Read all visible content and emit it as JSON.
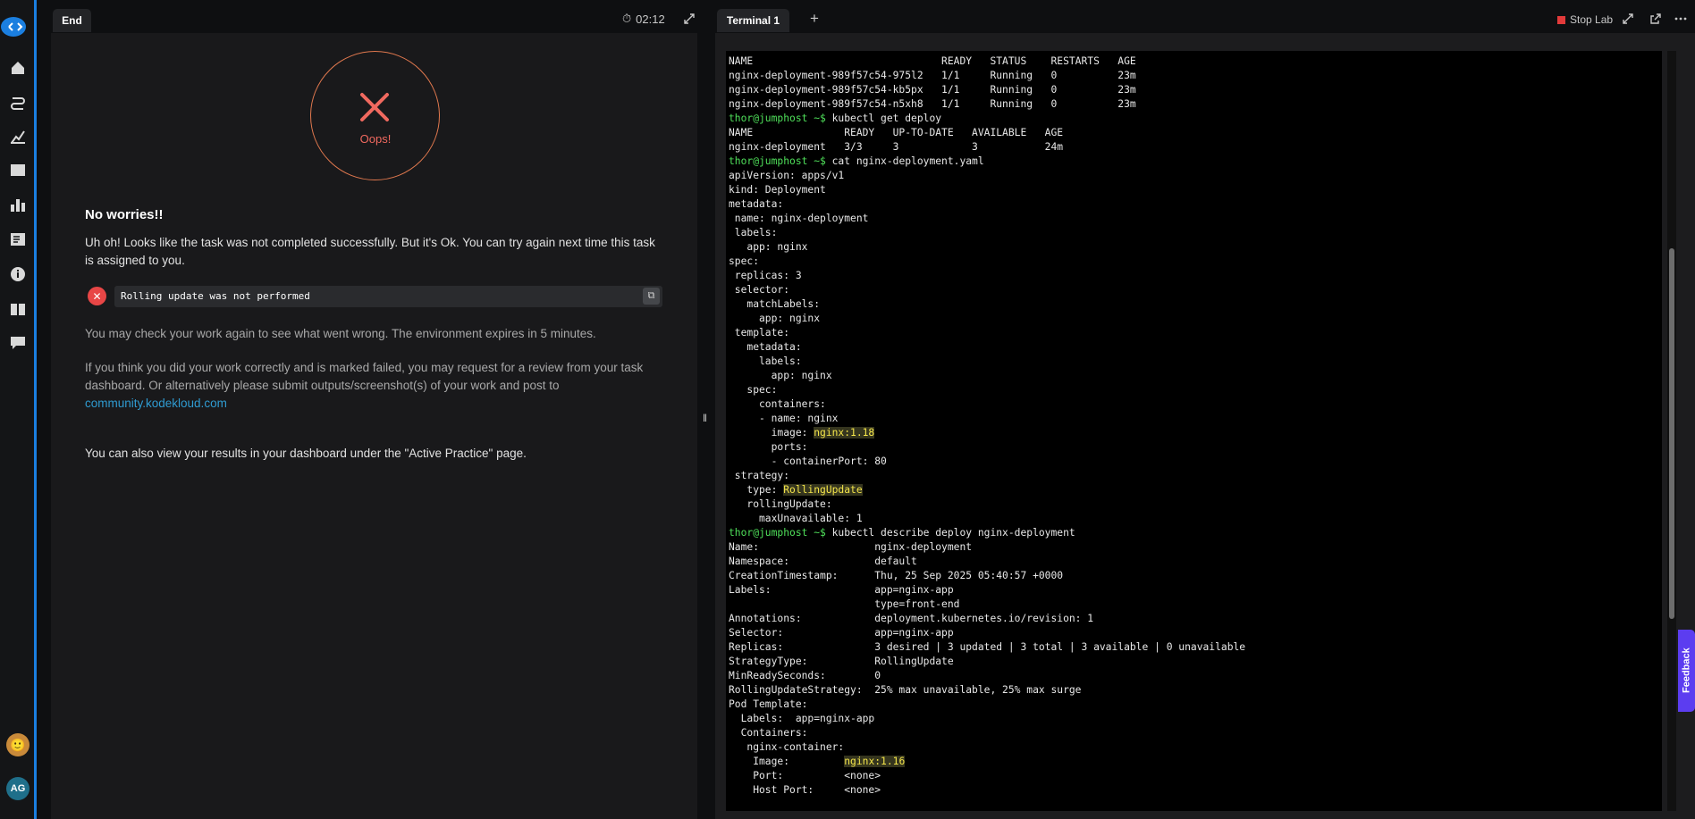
{
  "sidebar": {
    "icons": [
      "kodekloud-logo-icon",
      "home-icon",
      "route-icon",
      "chart-icon",
      "playground-icon",
      "leaderboard-icon",
      "notes-icon",
      "info-icon",
      "book-icon",
      "chat-icon"
    ],
    "user_initials": "AG"
  },
  "left_panel": {
    "tab_label": "End",
    "timer": "02:12",
    "result_label": "Oops!",
    "heading": "No worries!!",
    "intro_text": "Uh oh! Looks like the task was not completed successfully. But it's Ok. You can try again next time this task is assigned to you.",
    "failed_check": "Rolling update was not performed",
    "check_again_text": "You may check your work again to see what went wrong. The environment expires in 5 minutes.",
    "review_text": "If you think you did your work correctly and is marked failed, you may request for a review from your task dashboard. Or alternatively please submit outputs/screenshot(s) of your work and post to",
    "community_link": "community.kodekloud.com",
    "dashboard_text": "You can also view your results in your dashboard under the \"Active Practice\" page."
  },
  "right_panel": {
    "tab_label": "Terminal 1",
    "stop_lab_label": "Stop Lab",
    "feedback_label": "Feedback"
  },
  "terminal": {
    "lines": [
      {
        "t": "NAME                               READY   STATUS    RESTARTS   AGE"
      },
      {
        "t": "nginx-deployment-989f57c54-975l2   1/1     Running   0          23m"
      },
      {
        "t": "nginx-deployment-989f57c54-kb5px   1/1     Running   0          23m"
      },
      {
        "t": "nginx-deployment-989f57c54-n5xh8   1/1     Running   0          23m"
      },
      {
        "p": "thor@jumphost ~$ ",
        "t": "kubectl get deploy"
      },
      {
        "t": "NAME               READY   UP-TO-DATE   AVAILABLE   AGE"
      },
      {
        "t": "nginx-deployment   3/3     3            3           24m"
      },
      {
        "p": "thor@jumphost ~$ ",
        "t": "cat nginx-deployment.yaml"
      },
      {
        "t": "apiVersion: apps/v1"
      },
      {
        "t": "kind: Deployment"
      },
      {
        "t": "metadata:"
      },
      {
        "t": " name: nginx-deployment"
      },
      {
        "t": " labels:"
      },
      {
        "t": "   app: nginx"
      },
      {
        "t": "spec:"
      },
      {
        "t": " replicas: 3"
      },
      {
        "t": " selector:"
      },
      {
        "t": "   matchLabels:"
      },
      {
        "t": "     app: nginx"
      },
      {
        "t": " template:"
      },
      {
        "t": "   metadata:"
      },
      {
        "t": "     labels:"
      },
      {
        "t": "       app: nginx"
      },
      {
        "t": "   spec:"
      },
      {
        "t": "     containers:"
      },
      {
        "t": "     - name: nginx"
      },
      {
        "t": "       image: ",
        "h": "nginx:1.18"
      },
      {
        "t": "       ports:"
      },
      {
        "t": "       - containerPort: 80"
      },
      {
        "t": " strategy:"
      },
      {
        "t": "   type: ",
        "h": "RollingUpdate"
      },
      {
        "t": "   rollingUpdate:"
      },
      {
        "t": "     maxUnavailable: 1"
      },
      {
        "p": "thor@jumphost ~$ ",
        "t": "kubectl describe deploy nginx-deployment"
      },
      {
        "t": "Name:                   nginx-deployment"
      },
      {
        "t": "Namespace:              default"
      },
      {
        "t": "CreationTimestamp:      Thu, 25 Sep 2025 05:40:57 +0000"
      },
      {
        "t": "Labels:                 app=nginx-app"
      },
      {
        "t": "                        type=front-end"
      },
      {
        "t": "Annotations:            deployment.kubernetes.io/revision: 1"
      },
      {
        "t": "Selector:               app=nginx-app"
      },
      {
        "t": "Replicas:               3 desired | 3 updated | 3 total | 3 available | 0 unavailable"
      },
      {
        "t": "StrategyType:           RollingUpdate"
      },
      {
        "t": "MinReadySeconds:        0"
      },
      {
        "t": "RollingUpdateStrategy:  25% max unavailable, 25% max surge"
      },
      {
        "t": "Pod Template:"
      },
      {
        "t": "  Labels:  app=nginx-app"
      },
      {
        "t": "  Containers:"
      },
      {
        "t": "   nginx-container:"
      },
      {
        "t": "    Image:         ",
        "h": "nginx:1.16"
      },
      {
        "t": "    Port:          <none>"
      },
      {
        "t": "    Host Port:     <none>"
      }
    ]
  }
}
